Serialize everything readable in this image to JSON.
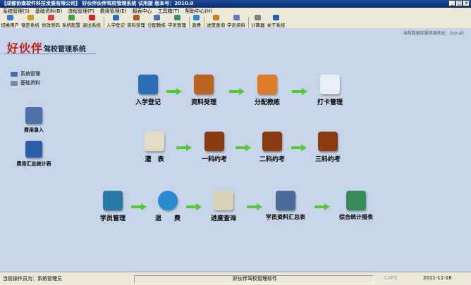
{
  "window": {
    "title": "【成都协南软件科技发展有限公司】  好伙伴伙伴驾校管理系统  试用版     版本号：2010.0",
    "buttons": [
      "_",
      "□",
      "×"
    ]
  },
  "menu": [
    "系统管理(S)",
    "基础资料(B)",
    "流程管理(F)",
    "费用管理(E)",
    "报表中心",
    "工具箱(T)",
    "帮助中心(H)"
  ],
  "toolbar": {
    "items": [
      "切换用户",
      "锁定系统",
      "修改密码",
      "系统配置",
      "退出系统",
      "入学登记",
      "资料受理",
      "分配教练",
      "学员管理",
      "退费",
      "进度查询",
      "学员资料",
      "计算器",
      "关于系统"
    ],
    "colors": [
      "#3a7bd5",
      "#c89b2a",
      "#d04545",
      "#4a9a4a",
      "#c82828",
      "#2d6fb5",
      "#b05a20",
      "#4a70b0",
      "#3c8f70",
      "#2a8ad0",
      "#d07a20",
      "#6a7abf",
      "#808080",
      "#2a5aa8"
    ]
  },
  "server_note": "当前数据库服务器地址：(Local)",
  "brand": {
    "name": "好伙伴",
    "subtitle": "驾校管理系统"
  },
  "sidebar": {
    "items": [
      {
        "label": "系统管理",
        "color": "#4a70b0"
      },
      {
        "label": "基础资料",
        "color": "#7a8aa0"
      }
    ],
    "shortcuts": [
      {
        "label": "费用录入",
        "color": "#4f6fa8"
      },
      {
        "label": "费用汇总统计表",
        "color": "#2e5ea8"
      }
    ]
  },
  "flow": {
    "row1": [
      {
        "label": "入学登记",
        "color": "#2d6fb5"
      },
      {
        "label": "资料受理",
        "color": "#b8631f"
      },
      {
        "label": "分配教练",
        "color": "#e07b2a"
      },
      {
        "label": "打卡管理",
        "color": "#e8eef5"
      }
    ],
    "row2": [
      {
        "label": "灌　表",
        "color": "#e2dcc4"
      },
      {
        "label": "一科约考",
        "color": "#8a3b12"
      },
      {
        "label": "二科约考",
        "color": "#8a3b12"
      },
      {
        "label": "三科约考",
        "color": "#8a3b12"
      }
    ],
    "row3": [
      {
        "label": "学员管理",
        "color": "#2a7aa8"
      },
      {
        "label": "退　　费",
        "color": "#2a8ad0"
      },
      {
        "label": "进度查询",
        "color": "#d9d2b8"
      },
      {
        "label": "学员资料汇总表",
        "color": "#4c6a9a"
      },
      {
        "label": "综合统计报表",
        "color": "#3a8a5a"
      }
    ],
    "arrow_color": "#55c837"
  },
  "status": {
    "operator": "当前操作员为：系统管理员",
    "app_name": "好伙伴驾校管理软件",
    "caps": "CAPS",
    "date": "2011-11-16"
  }
}
